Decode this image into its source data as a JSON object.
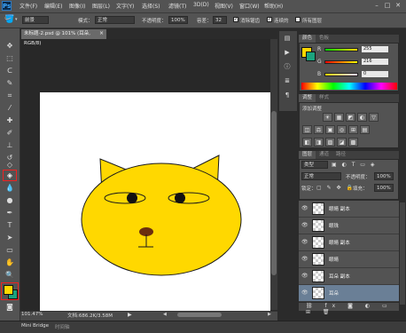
{
  "app": {
    "logo": "Ps"
  },
  "menu": [
    "文件(F)",
    "编辑(E)",
    "图像(I)",
    "图层(L)",
    "文字(Y)",
    "选择(S)",
    "滤镜(T)",
    "3D(D)",
    "视图(V)",
    "窗口(W)",
    "帮助(H)"
  ],
  "window_controls": [
    "–",
    "□",
    "✕"
  ],
  "options_bar": {
    "tool_icon": "paint-bucket-icon",
    "fill_source": "前景",
    "pattern_label": "",
    "mode_label": "模式：",
    "mode_value": "正常",
    "opacity_label": "不透明度：",
    "opacity_value": "100%",
    "tolerance_label": "容差：",
    "tolerance_value": "32",
    "antialias_label": "消除锯齿",
    "contiguous_label": "连续的",
    "all_layers_label": "所有图层"
  },
  "document": {
    "tab_title": "未标题-2.psd @ 101% (耳朵, RGB/8)",
    "tab_close": "×",
    "zoom": "101.47%",
    "doc_info": "文档:686.2K/3.58M"
  },
  "bottom_tabs": [
    "Mini Bridge",
    "时间轴"
  ],
  "color_panel": {
    "tabs": [
      "颜色",
      "色板"
    ],
    "channels": [
      {
        "name": "R",
        "value": "255"
      },
      {
        "name": "G",
        "value": "216"
      },
      {
        "name": "B",
        "value": "0"
      }
    ],
    "foreground": "#ffd800"
  },
  "adjust_panel": {
    "tabs": [
      "调整",
      "样式"
    ],
    "heading": "添加调整",
    "icons_row1": [
      "☀",
      "▦",
      "◩",
      "◐",
      "▽"
    ],
    "icons_row2": [
      "◫",
      "⚖",
      "▣",
      "◎",
      "⊞",
      "▤"
    ],
    "icons_row3": [
      "◧",
      "◨",
      "▨",
      "◪",
      "▩"
    ]
  },
  "layers_panel": {
    "tabs": [
      "图层",
      "通道",
      "路径"
    ],
    "filter_label": "类型",
    "blend_mode": "正常",
    "opacity_label": "不透明度：",
    "opacity_value": "100%",
    "lock_label": "锁定：",
    "fill_label": "填充：",
    "fill_value": "100%",
    "layers": [
      {
        "name": "眼睛 副本",
        "selected": false
      },
      {
        "name": "眼珠",
        "selected": false
      },
      {
        "name": "眼睛 副本",
        "selected": false
      },
      {
        "name": "眼睛",
        "selected": false
      },
      {
        "name": "耳朵 副本",
        "selected": false
      },
      {
        "name": "耳朵",
        "selected": true
      }
    ]
  },
  "colors": {
    "cat_face": "#ffd800",
    "outline": "#1a1a1a",
    "nose": "#6b2e0e",
    "highlight_box": "#e22222"
  }
}
